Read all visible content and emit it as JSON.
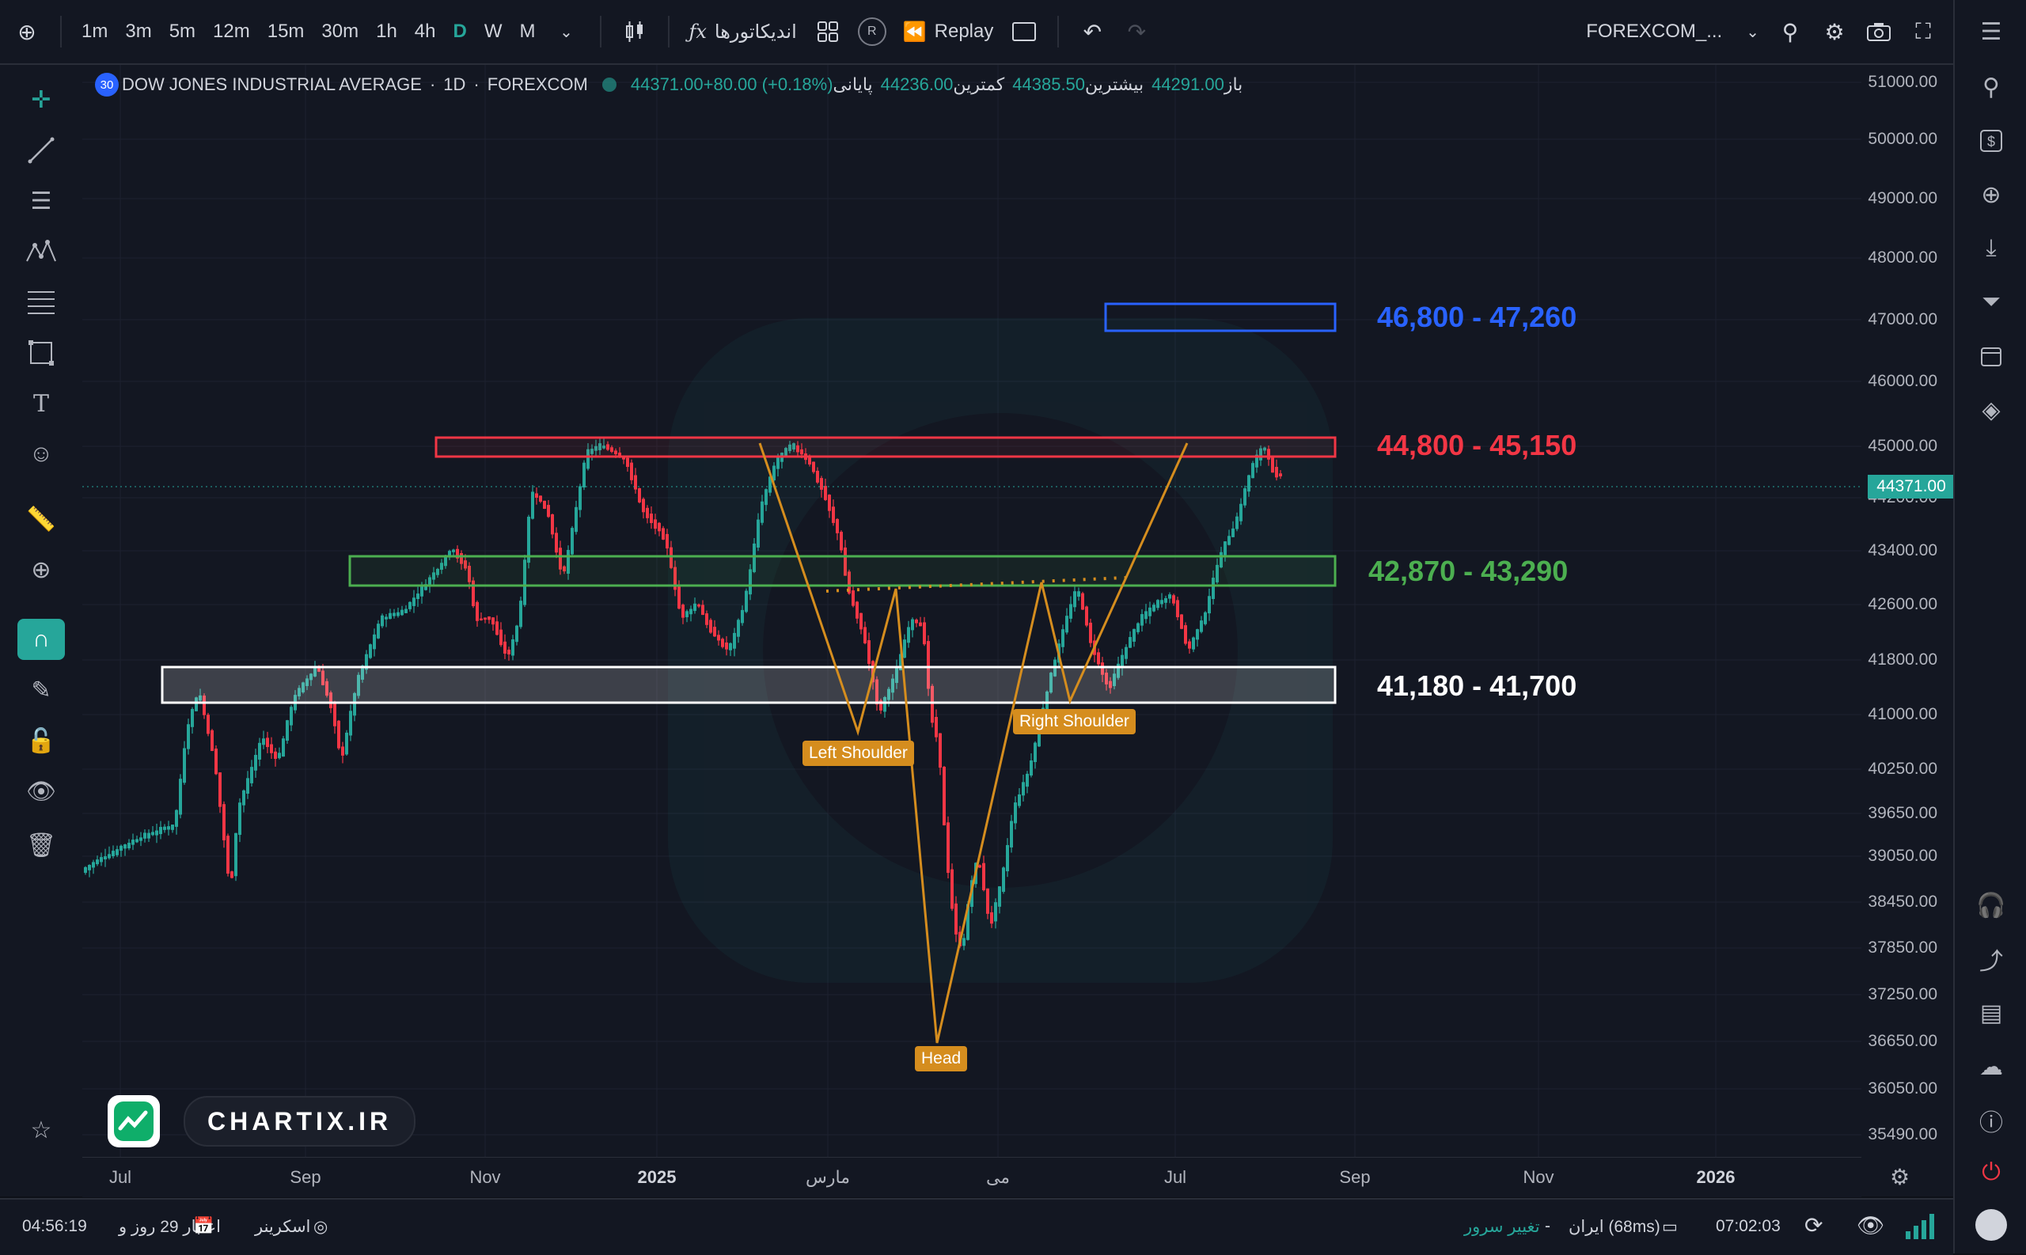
{
  "toolbar": {
    "timeframes": [
      "1m",
      "3m",
      "5m",
      "12m",
      "15m",
      "30m",
      "1h",
      "4h",
      "D",
      "W",
      "M"
    ],
    "active_timeframe": "D",
    "indicators_label": "اندیکاتورها",
    "replay_label": "Replay",
    "symbol_label": "FOREXCOM_...",
    "alert_badge": "R"
  },
  "legend": {
    "badge": "30",
    "symbol": "DOW JONES INDUSTRIAL AVERAGE",
    "interval": "1D",
    "exchange": "FOREXCOM",
    "open_label": "باز",
    "open_value": "44291.00",
    "high_label": "بیشترین",
    "high_value": "44385.50",
    "low_label": "کمترین",
    "low_value": "44236.00",
    "close_label": "پایانی",
    "close_value": "44371.00",
    "change": "+80.00 (+0.18%)"
  },
  "zones": [
    {
      "label": "46,800 - 47,260",
      "color": "#2962ff"
    },
    {
      "label": "44,800 - 45,150",
      "color": "#f23645"
    },
    {
      "label": "42,870 - 43,290",
      "color": "#4caf50"
    },
    {
      "label": "41,180 - 41,700",
      "color": "#ffffff"
    }
  ],
  "pattern_labels": {
    "left_shoulder": "Left Shoulder",
    "head": "Head",
    "right_shoulder": "Right Shoulder"
  },
  "price_axis": [
    "51000.00",
    "50000.00",
    "49000.00",
    "48000.00",
    "47000.00",
    "46000.00",
    "45000.00",
    "44200.00",
    "43400.00",
    "42600.00",
    "41800.00",
    "41000.00",
    "40250.00",
    "39650.00",
    "39050.00",
    "38450.00",
    "37850.00",
    "37250.00",
    "36650.00",
    "36050.00",
    "35490.00"
  ],
  "current_price": "44371.00",
  "time_axis": [
    "Jul",
    "Sep",
    "Nov",
    "2025",
    "مارس",
    "می",
    "Jul",
    "Sep",
    "Nov",
    "2026"
  ],
  "watermark_logo": "CHARTIX.IR",
  "statusbar": {
    "time_left": "04:56:19",
    "credit": "اعتبار 29 روز و",
    "screener": "اسکرینر",
    "server_change": "تغییر سرور",
    "dash": "-",
    "server": "ایران (68ms)",
    "clock": "07:02:03"
  },
  "colors": {
    "background": "#131722",
    "up_candle": "#26a69a",
    "down_candle": "#f23645",
    "pattern_line": "#d58d1e"
  }
}
